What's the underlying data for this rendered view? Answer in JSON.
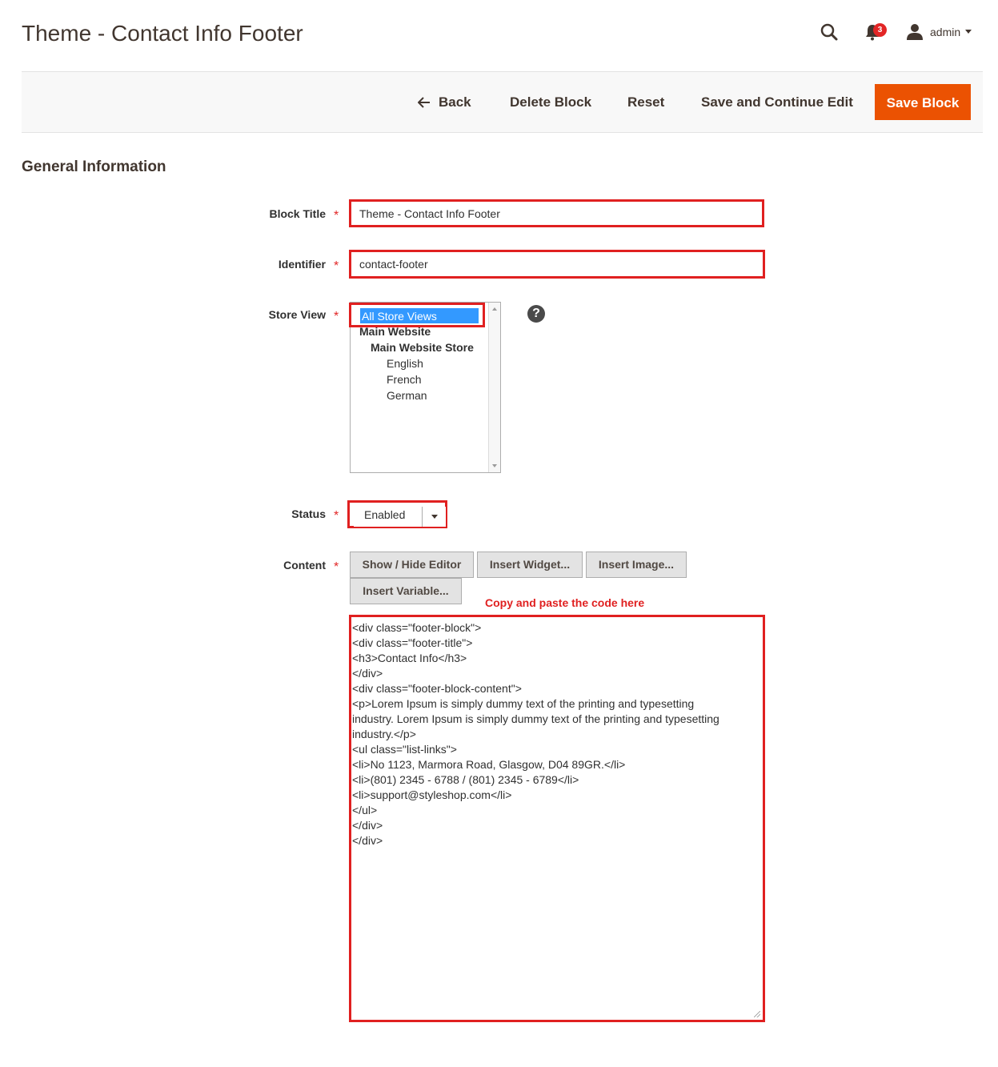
{
  "header": {
    "title": "Theme - Contact Info Footer",
    "notification_count": "3",
    "user_name": "admin"
  },
  "actions": {
    "back": "Back",
    "delete": "Delete Block",
    "reset": "Reset",
    "save_continue": "Save and Continue Edit",
    "save": "Save Block"
  },
  "section": {
    "title": "General Information"
  },
  "form": {
    "required_mark": "*",
    "block_title": {
      "label": "Block Title",
      "value": "Theme - Contact Info Footer"
    },
    "identifier": {
      "label": "Identifier",
      "value": "contact-footer"
    },
    "store_view": {
      "label": "Store View",
      "options": [
        "All Store Views",
        "Main Website",
        "Main Website Store",
        "English",
        "French",
        "German"
      ],
      "selected": "All Store Views",
      "help_symbol": "?"
    },
    "status": {
      "label": "Status",
      "value": "Enabled"
    },
    "content": {
      "label": "Content",
      "buttons": [
        "Show / Hide Editor",
        "Insert Widget...",
        "Insert Image...",
        "Insert Variable..."
      ],
      "hint": "Copy and paste the code here",
      "lines": [
        "<div class=\"footer-block\">",
        "<div class=\"footer-title\">",
        "<h3>Contact Info</h3>",
        "</div>",
        "<div class=\"footer-block-content\">",
        "<p>Lorem Ipsum is simply dummy text of the printing and typesetting",
        "industry. Lorem Ipsum is simply dummy text of the printing and typesetting",
        "industry.</p>",
        "<ul class=\"list-links\">",
        "<li>No 1123, Marmora Road, Glasgow, D04 89GR.</li>",
        "<li>(801) 2345 - 6788 / (801) 2345 - 6789</li>",
        "<li>support@styleshop.com</li>",
        "</ul>",
        "</div>",
        "</div>"
      ]
    }
  },
  "colors": {
    "primary_button": "#eb5202",
    "highlight_border": "#e02020",
    "selected_option": "#3399ff"
  }
}
